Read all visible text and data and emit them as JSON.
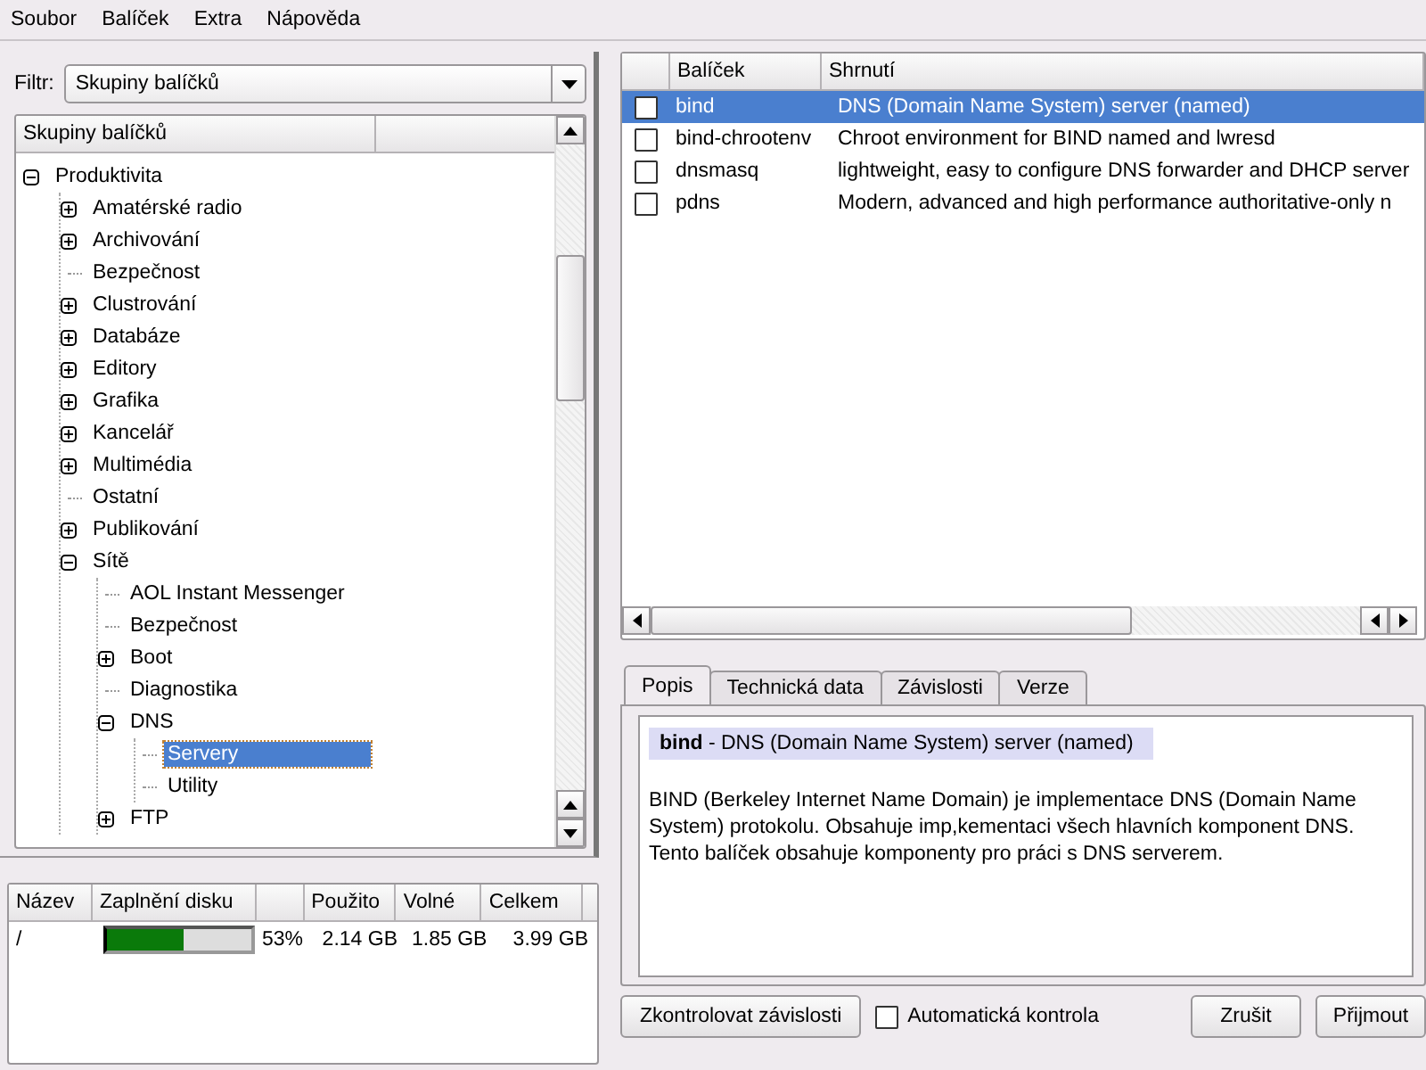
{
  "menu": [
    {
      "label": "Soubor"
    },
    {
      "label": "Balíček"
    },
    {
      "label": "Extra"
    },
    {
      "label": "Nápověda"
    }
  ],
  "filter": {
    "label": "Filtr:",
    "value": "Skupiny balíčků"
  },
  "tree": {
    "column": "Skupiny balíčků",
    "items": [
      {
        "label": "Produktivita",
        "kind": "group",
        "expanded": true,
        "selected": false,
        "children": [
          {
            "label": "Amatérské radio",
            "kind": "group",
            "expanded": false,
            "selected": false
          },
          {
            "label": "Archivování",
            "kind": "group",
            "expanded": false,
            "selected": false
          },
          {
            "label": "Bezpečnost",
            "kind": "leaf",
            "selected": false
          },
          {
            "label": "Clustrování",
            "kind": "group",
            "expanded": false,
            "selected": false
          },
          {
            "label": "Databáze",
            "kind": "group",
            "expanded": false,
            "selected": false
          },
          {
            "label": "Editory",
            "kind": "group",
            "expanded": false,
            "selected": false
          },
          {
            "label": "Grafika",
            "kind": "group",
            "expanded": false,
            "selected": false
          },
          {
            "label": "Kancelář",
            "kind": "group",
            "expanded": false,
            "selected": false
          },
          {
            "label": "Multimédia",
            "kind": "group",
            "expanded": false,
            "selected": false
          },
          {
            "label": "Ostatní",
            "kind": "leaf",
            "selected": false
          },
          {
            "label": "Publikování",
            "kind": "group",
            "expanded": false,
            "selected": false
          },
          {
            "label": "Sítě",
            "kind": "group",
            "expanded": true,
            "selected": false,
            "children": [
              {
                "label": "AOL Instant Messenger",
                "kind": "leaf",
                "selected": false
              },
              {
                "label": "Bezpečnost",
                "kind": "leaf",
                "selected": false
              },
              {
                "label": "Boot",
                "kind": "group",
                "expanded": false,
                "selected": false
              },
              {
                "label": "Diagnostika",
                "kind": "leaf",
                "selected": false
              },
              {
                "label": "DNS",
                "kind": "group",
                "expanded": true,
                "selected": false,
                "children": [
                  {
                    "label": "Servery",
                    "kind": "leaf",
                    "selected": true
                  },
                  {
                    "label": "Utility",
                    "kind": "leaf",
                    "selected": false
                  }
                ]
              },
              {
                "label": "FTP",
                "kind": "group",
                "expanded": false,
                "selected": false
              }
            ]
          }
        ]
      }
    ]
  },
  "disk": {
    "columns": [
      "Název",
      "Zaplnění disku",
      "Použito",
      "Volné",
      "Celkem"
    ],
    "rows": [
      {
        "name": "/",
        "level": 0.53,
        "percent": "53%",
        "used": "2.14 GB",
        "free": "1.85 GB",
        "total": "3.99 GB"
      }
    ]
  },
  "packages": {
    "columns": [
      "Balíček",
      "Shrnutí"
    ],
    "rows": [
      {
        "name": "bind",
        "summary": "DNS (Domain Name System) server (named)",
        "checked": false,
        "selected": true
      },
      {
        "name": "bind-chrootenv",
        "summary": "Chroot environment for BIND named and lwresd",
        "checked": false,
        "selected": false
      },
      {
        "name": "dnsmasq",
        "summary": "lightweight, easy to configure DNS forwarder and DHCP server",
        "checked": false,
        "selected": false
      },
      {
        "name": "pdns",
        "summary": "Modern, advanced and high performance authoritative-only n",
        "checked": false,
        "selected": false
      }
    ]
  },
  "tabs": [
    {
      "label": "Popis",
      "selected": true
    },
    {
      "label": "Technická data",
      "selected": false
    },
    {
      "label": "Závislosti",
      "selected": false
    },
    {
      "label": "Verze",
      "selected": false
    }
  ],
  "description": {
    "heading": "**bind** - DNS (Domain Name System) server (named)",
    "body": "BIND (Berkeley Internet Name Domain) je implementace DNS (Domain Name System) protokolu. Obsahuje imp,kementaci všech hlavních komponent DNS. Tento balíček obsahuje komponenty pro práci s DNS serverem."
  },
  "footer": {
    "check_button": "Zkontrolovat závislosti",
    "auto_check": {
      "label": "Automatická kontrola",
      "checked": false
    },
    "buttons": [
      "Zrušit",
      "Přijmout"
    ]
  }
}
